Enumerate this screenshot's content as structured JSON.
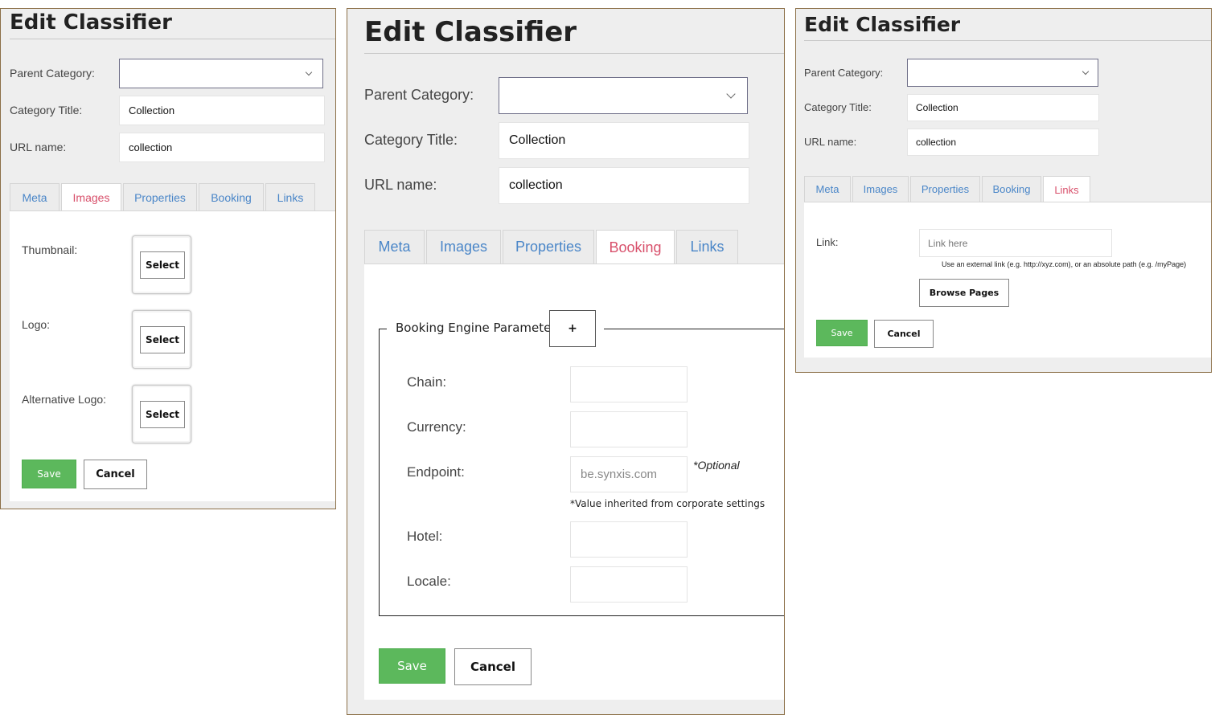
{
  "panel_images": {
    "title": "Edit Classifier",
    "parent_category_label": "Parent Category:",
    "parent_category_value": "",
    "category_title_label": "Category Title:",
    "category_title_value": "Collection",
    "url_name_label": "URL name:",
    "url_name_value": "collection",
    "tabs": [
      "Meta",
      "Images",
      "Properties",
      "Booking",
      "Links"
    ],
    "active_tab": "Images",
    "thumbnail_label": "Thumbnail:",
    "logo_label": "Logo:",
    "alt_logo_label": "Alternative Logo:",
    "select_label": "Select",
    "save_label": "Save",
    "cancel_label": "Cancel"
  },
  "panel_booking": {
    "title": "Edit Classifier",
    "parent_category_label": "Parent Category:",
    "parent_category_value": "",
    "category_title_label": "Category Title:",
    "category_title_value": "Collection",
    "url_name_label": "URL name:",
    "url_name_value": "collection",
    "tabs": [
      "Meta",
      "Images",
      "Properties",
      "Booking",
      "Links"
    ],
    "active_tab": "Booking",
    "fieldset_legend": "Booking Engine Parameters",
    "add_symbol": "+",
    "chain_label": "Chain:",
    "chain_value": "",
    "currency_label": "Currency:",
    "currency_value": "",
    "endpoint_label": "Endpoint:",
    "endpoint_placeholder": "be.synxis.com",
    "optional_note": "*Optional",
    "inherited_note": "*Value inherited from corporate settings",
    "hotel_label": "Hotel:",
    "hotel_value": "",
    "locale_label": "Locale:",
    "locale_value": "",
    "save_label": "Save",
    "cancel_label": "Cancel"
  },
  "panel_links": {
    "title": "Edit Classifier",
    "parent_category_label": "Parent Category:",
    "parent_category_value": "",
    "category_title_label": "Category Title:",
    "category_title_value": "Collection",
    "url_name_label": "URL name:",
    "url_name_value": "collection",
    "tabs": [
      "Meta",
      "Images",
      "Properties",
      "Booking",
      "Links"
    ],
    "active_tab": "Links",
    "link_label": "Link:",
    "link_placeholder": "Link here",
    "link_help": "Use an external link (e.g. http://xyz.com), or an absolute path (e.g. /myPage)",
    "browse_label": "Browse Pages",
    "save_label": "Save",
    "cancel_label": "Cancel"
  },
  "colors": {
    "active_tab": "#d8506b",
    "tab_text": "#4a86c8",
    "save_button": "#5cb85c",
    "panel_border": "#8b6f47",
    "panel_background": "#eeeeee"
  }
}
